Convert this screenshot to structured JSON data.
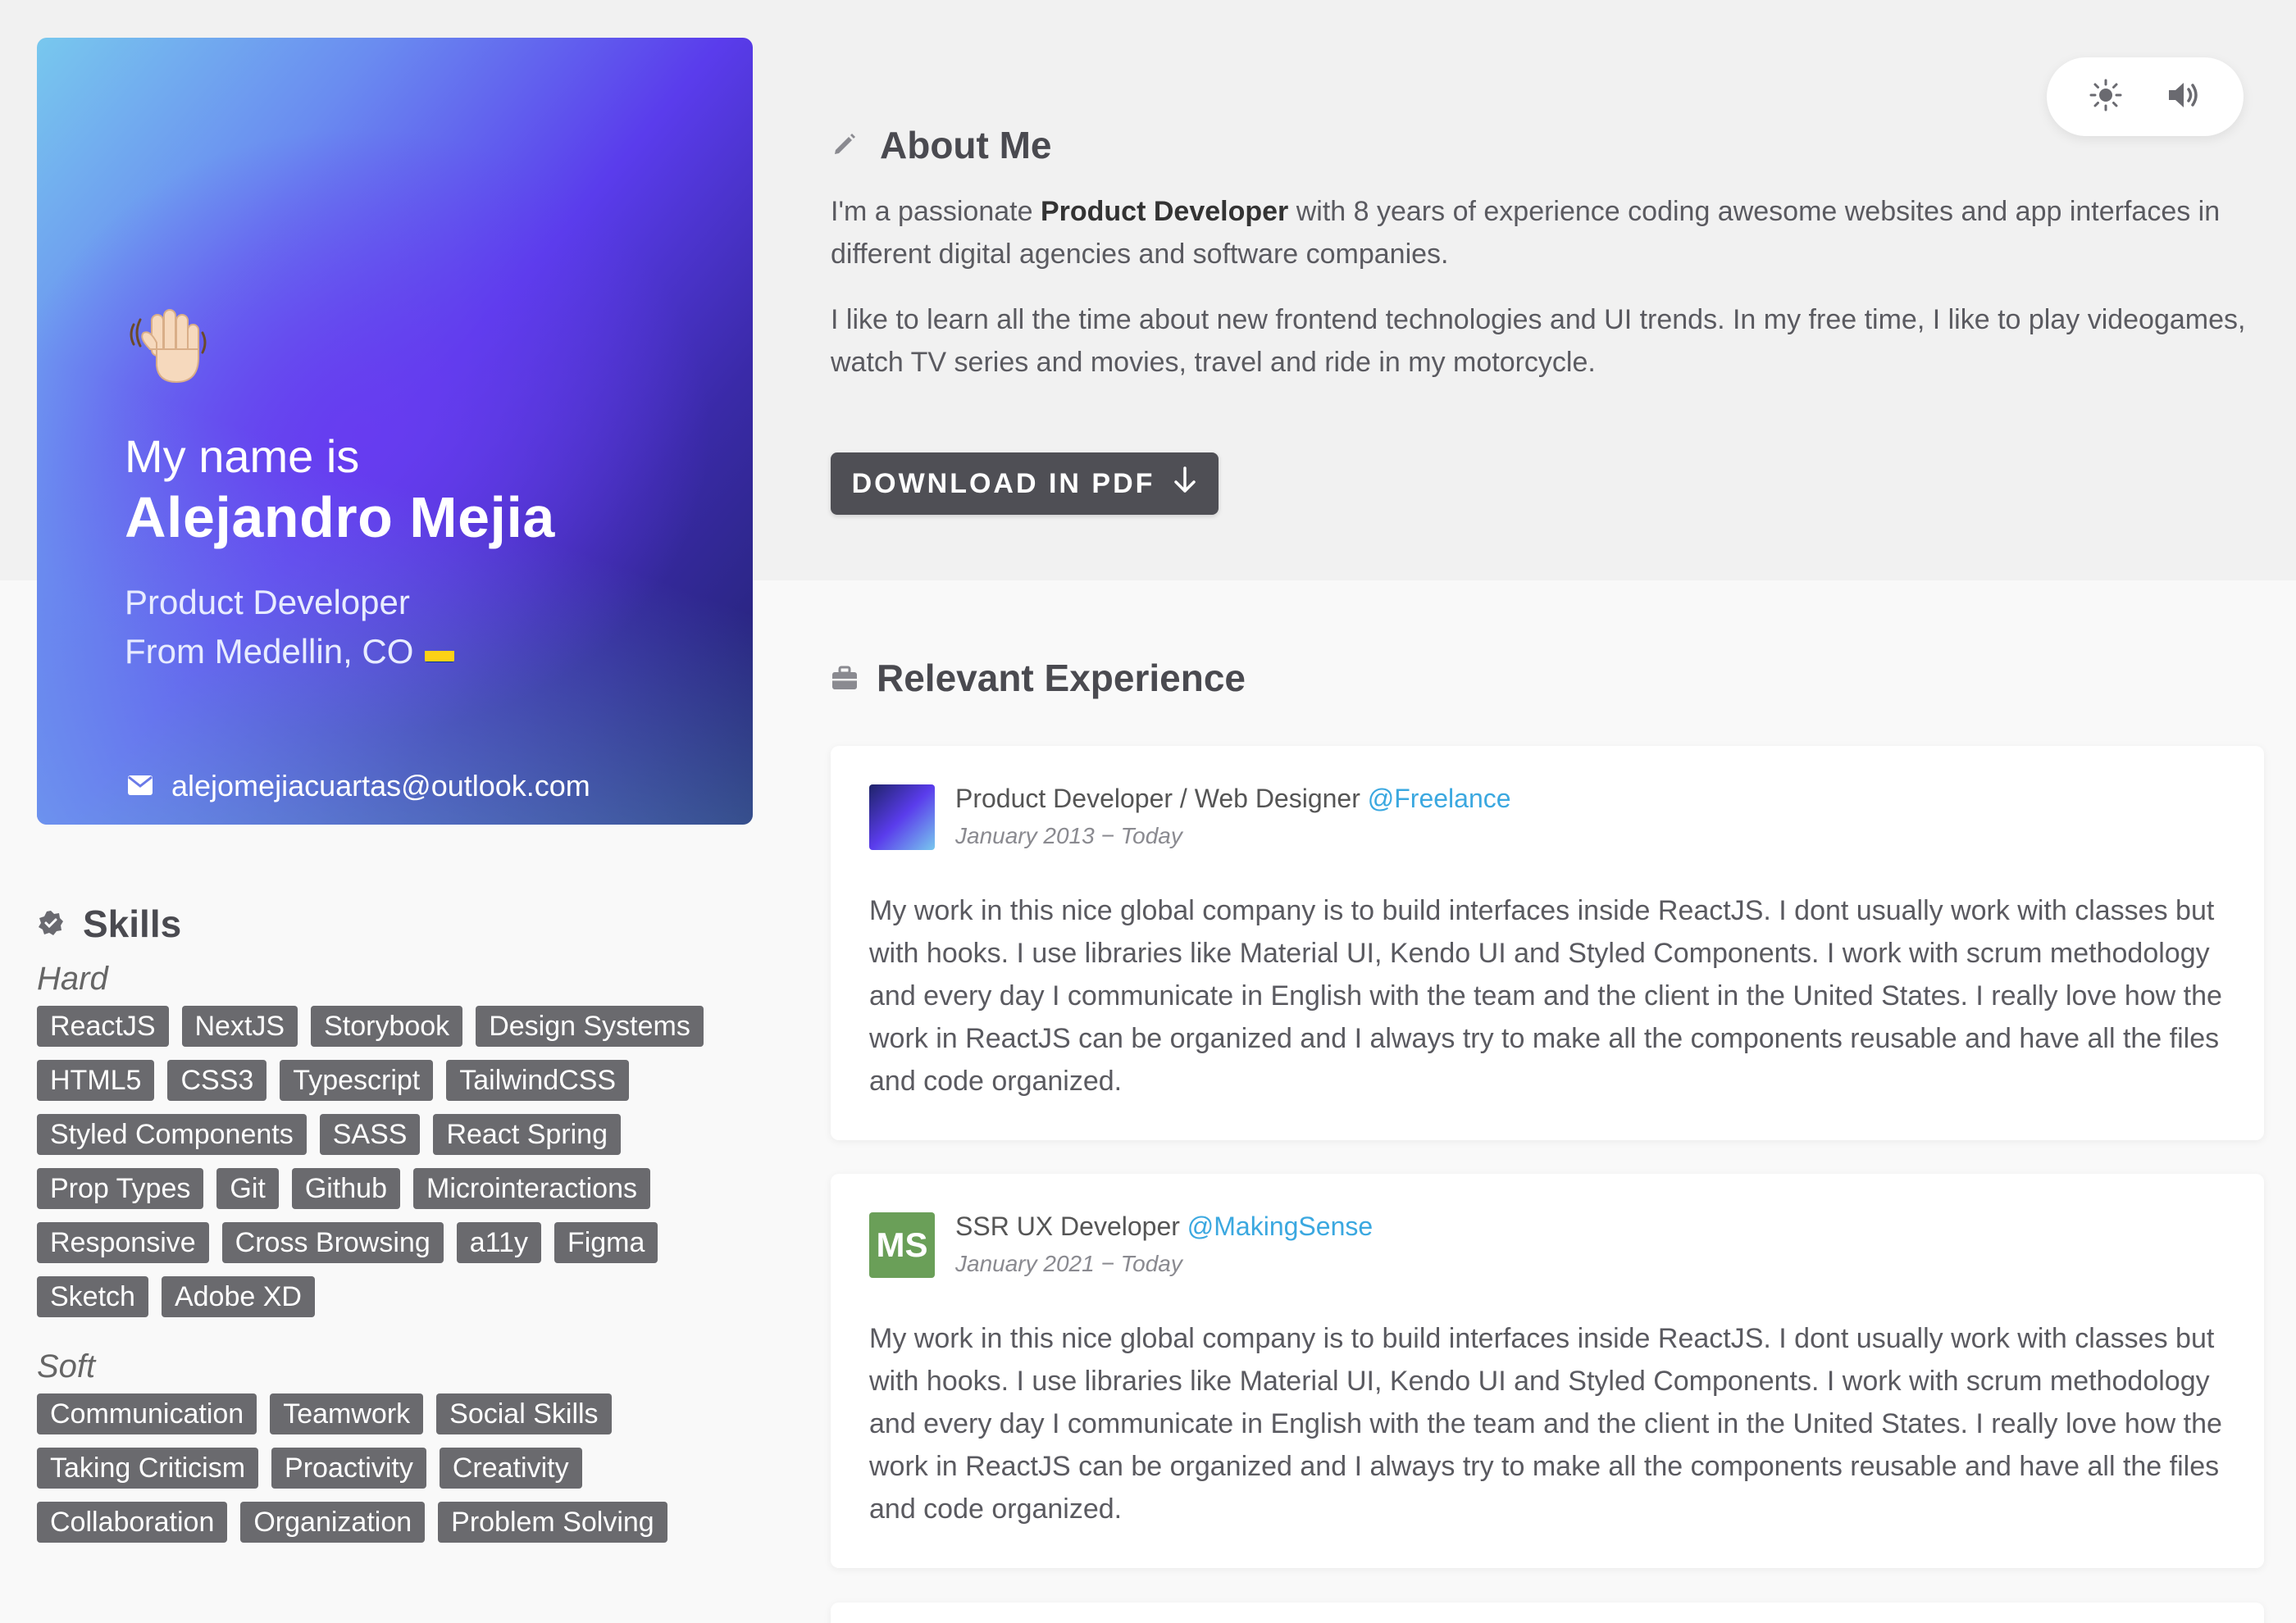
{
  "profile": {
    "wave_icon": "waving-hand-icon",
    "intro": "My name is",
    "name": "Alejandro Mejia",
    "role": "Product Developer",
    "location": "From Medellin, CO",
    "flag_icon": "colombia-flag-icon",
    "email": "alejomejiacuartas@outlook.com",
    "email_icon": "envelope-icon"
  },
  "skills": {
    "title": "Skills",
    "hard_label": "Hard",
    "hard": [
      "ReactJS",
      "NextJS",
      "Storybook",
      "Design Systems",
      "HTML5",
      "CSS3",
      "Typescript",
      "TailwindCSS",
      "Styled Components",
      "SASS",
      "React Spring",
      "Prop Types",
      "Git",
      "Github",
      "Microinteractions",
      "Responsive",
      "Cross Browsing",
      "a11y",
      "Figma",
      "Sketch",
      "Adobe XD"
    ],
    "soft_label": "Soft",
    "soft": [
      "Communication",
      "Teamwork",
      "Social Skills",
      "Taking Criticism",
      "Proactivity",
      "Creativity",
      "Collaboration",
      "Organization",
      "Problem Solving"
    ]
  },
  "controls": {
    "theme_icon": "sun-icon",
    "sound_icon": "speaker-icon"
  },
  "about": {
    "title": "About Me",
    "p1_pre": "I'm a passionate ",
    "p1_bold": "Product Developer",
    "p1_post": " with 8 years of experience coding awesome websites and app interfaces in different digital agencies and software companies.",
    "p2": "I like to learn all the time about new frontend technologies and UI trends. In my free time, I like to play videogames, watch TV series and movies, travel and ride in my motorcycle.",
    "download_label": "DOWNLOAD IN PDF"
  },
  "experience": {
    "title": "Relevant Experience",
    "items": [
      {
        "role": "Product Developer / Web Designer",
        "company": "@Freelance",
        "dates": "January 2013 − Today",
        "logo_text": "",
        "description": "My work in this nice global company is to build interfaces inside ReactJS. I dont usually work with classes but with hooks. I use libraries like Material UI, Kendo UI and Styled Components. I work with scrum methodology and every day I communicate in English with the team and the client in the United States. I really love how the work in ReactJS can be organized and I always try to make all the components reusable and have all the files and code organized."
      },
      {
        "role": "SSR UX Developer",
        "company": "@MakingSense",
        "dates": "January 2021 − Today",
        "logo_text": "MS",
        "description": "My work in this nice global company is to build interfaces inside ReactJS. I dont usually work with classes but with hooks. I use libraries like Material UI, Kendo UI and Styled Components. I work with scrum methodology and every day I communicate in English with the team and the client in the United States. I really love how the work in ReactJS can be organized and I always try to make all the components reusable and have all the files and code organized."
      }
    ]
  }
}
